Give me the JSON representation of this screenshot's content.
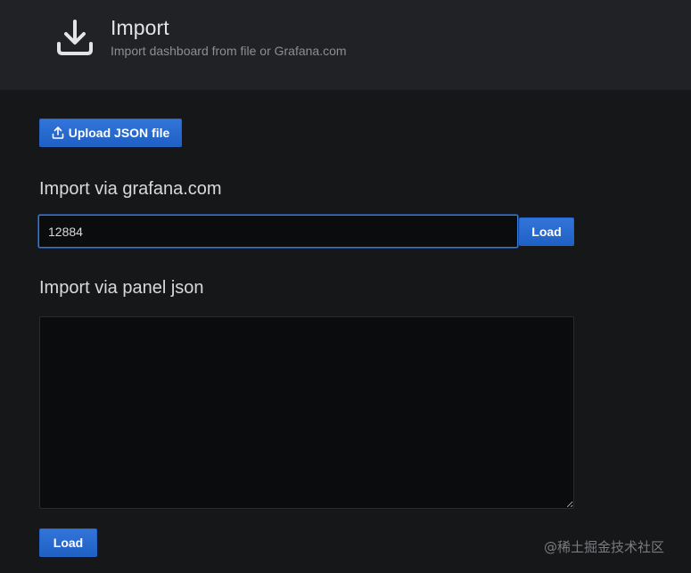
{
  "header": {
    "icon": "download-icon",
    "title": "Import",
    "subtitle": "Import dashboard from file or Grafana.com"
  },
  "upload": {
    "icon": "upload-icon",
    "label": "Upload JSON file"
  },
  "grafana_com": {
    "section_title": "Import via grafana.com",
    "input_value": "12884",
    "load_label": "Load"
  },
  "panel_json": {
    "section_title": "Import via panel json",
    "textarea_value": "",
    "load_label": "Load"
  },
  "watermark": "@稀土掘金技术社区",
  "colors": {
    "background": "#161719",
    "header": "#202226",
    "primary_button": "#3274d9",
    "input_focus_border": "#3a7bd5"
  }
}
